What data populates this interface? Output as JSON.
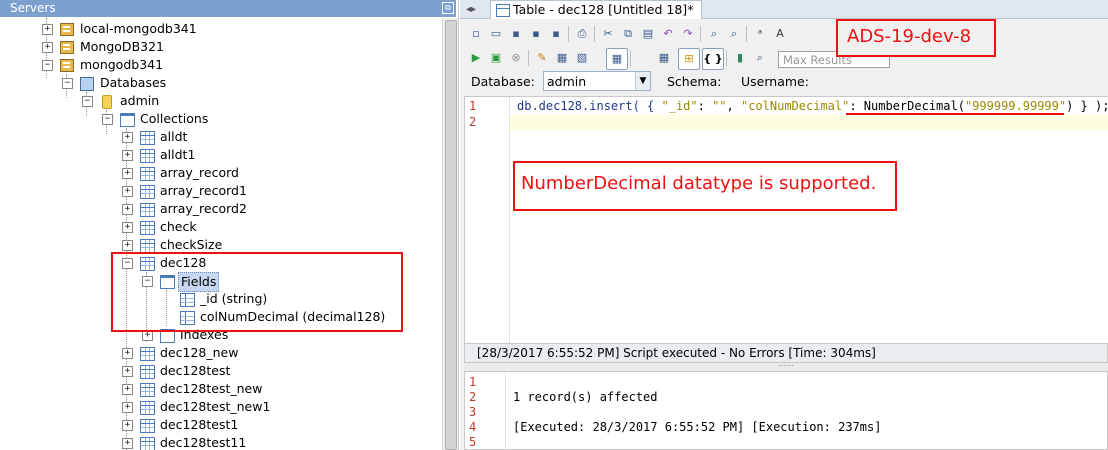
{
  "servers_panel": {
    "title": "Servers",
    "restore_glyph": "⧉"
  },
  "tree": {
    "servers": [
      "local-mongodb341",
      "MongoDB321",
      "mongodb341"
    ],
    "databases_label": "Databases",
    "db_name": "admin",
    "collections_label": "Collections",
    "collections_before": [
      "alldt",
      "alldt1",
      "array_record",
      "array_record1",
      "array_record2",
      "check",
      "checkSize"
    ],
    "selected_collection": "dec128",
    "fields_label": "Fields",
    "fields": [
      "_id (string)",
      "colNumDecimal (decimal128)"
    ],
    "indexes_label": "Indexes",
    "collections_after": [
      "dec128_new",
      "dec128test",
      "dec128test_new",
      "dec128test_new1",
      "dec128test1",
      "dec128test11"
    ]
  },
  "editor": {
    "tab_title": "Table - dec128 [Untitled 18]*",
    "max_results_placeholder": "Max Results",
    "database_label": "Database:",
    "database_value": "admin",
    "schema_label": "Schema:",
    "username_label": "Username:",
    "code_line_numbers": [
      "1",
      "2"
    ],
    "code": {
      "part1": "db.dec128.insert( { ",
      "k1": "\"_id\"",
      "p2": ": ",
      "v1": "\"\"",
      "p3": ", ",
      "k2": "\"colNumDecimal\"",
      "p4": ": NumberDecimal(",
      "v2": "\"999999.99999\"",
      "p5": ") } );"
    },
    "status_text": "[28/3/2017 6:55:52 PM] Script executed - No Errors [Time: 304ms]",
    "splitter_glyph": "⋯⋯",
    "result_line_numbers": [
      "1",
      "2",
      "3",
      "4",
      "5"
    ],
    "result_lines": [
      "",
      "1 record(s) affected",
      "",
      "[Executed: 28/3/2017 6:55:52 PM] [Execution: 237ms]",
      ""
    ]
  },
  "annotations": {
    "note": "NumberDecimal datatype is supported.",
    "tag": "ADS-19-dev-8",
    "color": "#ee1111"
  },
  "toolbar_icons": {
    "row1": [
      "new-icon",
      "open-icon",
      "save-icon",
      "save-as-icon",
      "save-all-icon",
      "print-icon",
      "cut-icon",
      "copy-icon",
      "paste-icon",
      "undo-icon",
      "redo-icon",
      "find-icon",
      "replace-icon",
      "font-larger-icon",
      "font-smaller-icon"
    ],
    "row2": [
      "execute-icon",
      "execute-current-icon",
      "stop-icon",
      "explain-icon",
      "history-icon",
      "grid-results-icon",
      "tree-results-icon",
      "json-results-icon",
      "export-icon",
      "query-analyzer-icon"
    ]
  }
}
